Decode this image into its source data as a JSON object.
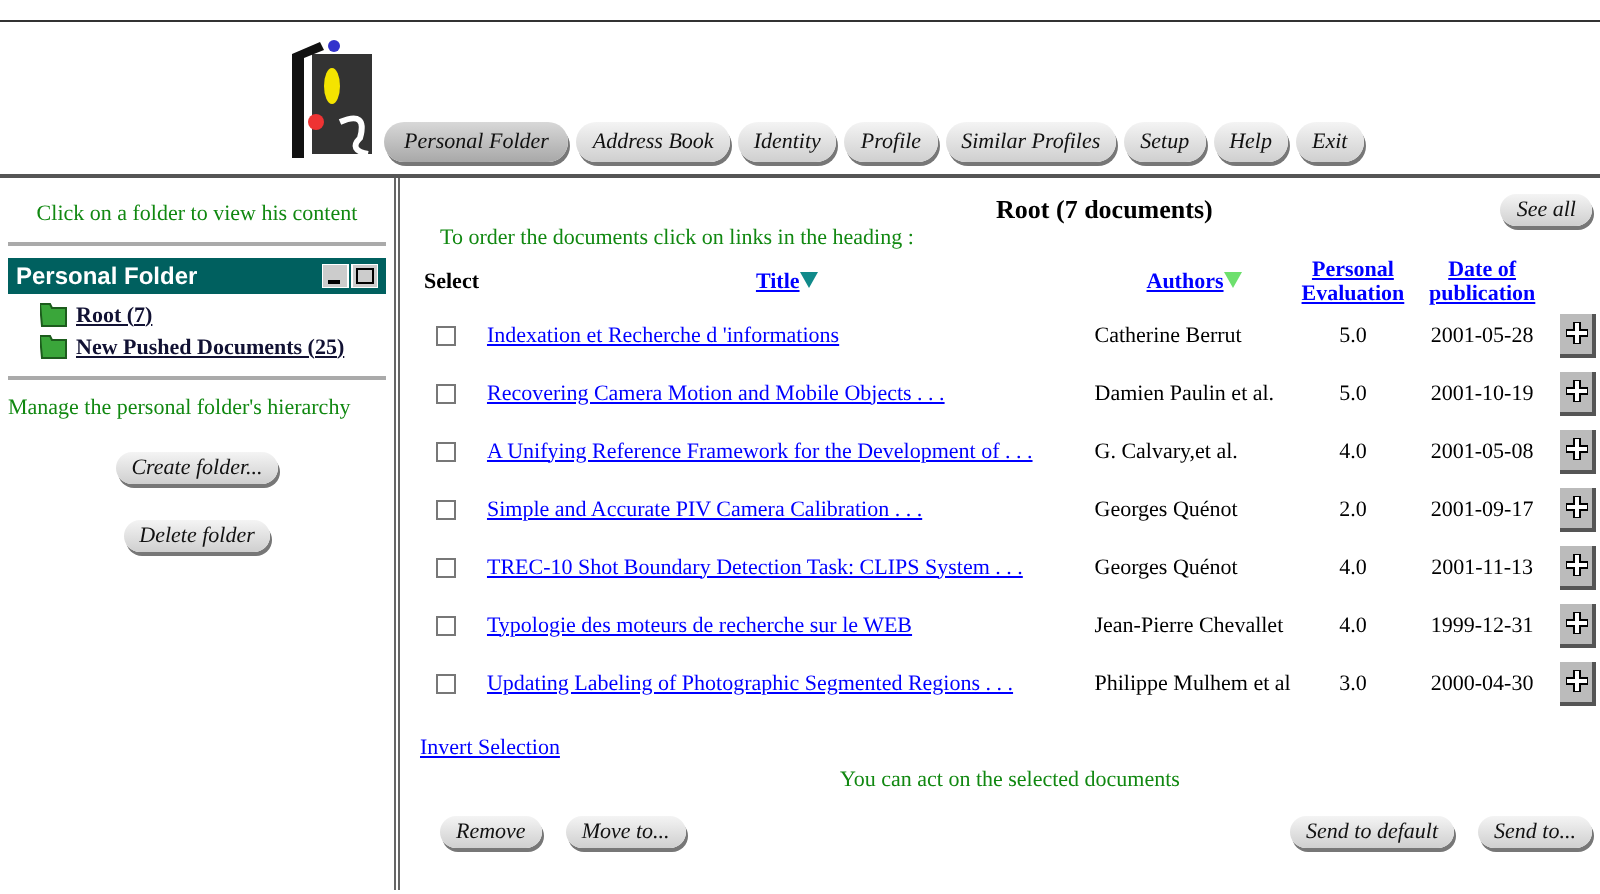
{
  "nav": {
    "tabs": [
      {
        "label": "Personal Folder",
        "selected": true
      },
      {
        "label": "Address Book",
        "selected": false
      },
      {
        "label": "Identity",
        "selected": false
      },
      {
        "label": "Profile",
        "selected": false
      },
      {
        "label": "Similar Profiles",
        "selected": false
      },
      {
        "label": "Setup",
        "selected": false
      },
      {
        "label": "Help",
        "selected": false
      },
      {
        "label": "Exit",
        "selected": false
      }
    ]
  },
  "sidebar": {
    "hint": "Click on a folder to view his content",
    "panel_title": "Personal Folder",
    "folders": [
      {
        "label": "Root (7)"
      },
      {
        "label": "New Pushed Documents (25)"
      }
    ],
    "manage_hint": "Manage the personal folder's hierarchy",
    "buttons": [
      "Create folder...",
      "Delete folder"
    ]
  },
  "main": {
    "title": "Root (7 documents)",
    "see_all": "See all",
    "order_hint": "To order the documents click on links in the heading :",
    "columns": [
      {
        "label": "Select",
        "kind": "plain"
      },
      {
        "label": "Title",
        "kind": "sort",
        "sorted": true
      },
      {
        "label": "Authors",
        "kind": "sort",
        "sorted": false
      },
      {
        "label": "Personal Evaluation",
        "kind": "link"
      },
      {
        "label": "Date of publication",
        "kind": "link"
      }
    ],
    "rows": [
      {
        "checked": false,
        "title": "Indexation et Recherche d 'informations",
        "authors": "Catherine Berrut",
        "evaluation": "5.0",
        "date": "2001-05-28"
      },
      {
        "checked": false,
        "title": "Recovering Camera Motion and Mobile Objects . . .",
        "authors": "Damien Paulin et al.",
        "evaluation": "5.0",
        "date": "2001-10-19"
      },
      {
        "checked": false,
        "title": "A Unifying Reference Framework for the Development of . . .",
        "authors": "G. Calvary,et al.",
        "evaluation": "4.0",
        "date": "2001-05-08"
      },
      {
        "checked": false,
        "title": "Simple and Accurate PIV Camera Calibration . . .",
        "authors": "Georges Quénot",
        "evaluation": "2.0",
        "date": "2001-09-17"
      },
      {
        "checked": false,
        "title": "TREC-10 Shot Boundary Detection Task: CLIPS System . . .",
        "authors": "Georges Quénot",
        "evaluation": "4.0",
        "date": "2001-11-13"
      },
      {
        "checked": false,
        "title": "Typologie des moteurs de recherche sur le WEB",
        "authors": "Jean-Pierre Chevallet",
        "evaluation": "4.0",
        "date": "1999-12-31"
      },
      {
        "checked": false,
        "title": "Updating Labeling of Photographic Segmented Regions . . .",
        "authors": "Philippe Mulhem et al",
        "evaluation": "3.0",
        "date": "2000-04-30"
      }
    ],
    "invert_selection": "Invert Selection",
    "act_hint": "You can act on the selected documents",
    "left_buttons": [
      "Remove",
      "Move to..."
    ],
    "right_buttons": [
      "Send to default",
      "Send to..."
    ]
  }
}
